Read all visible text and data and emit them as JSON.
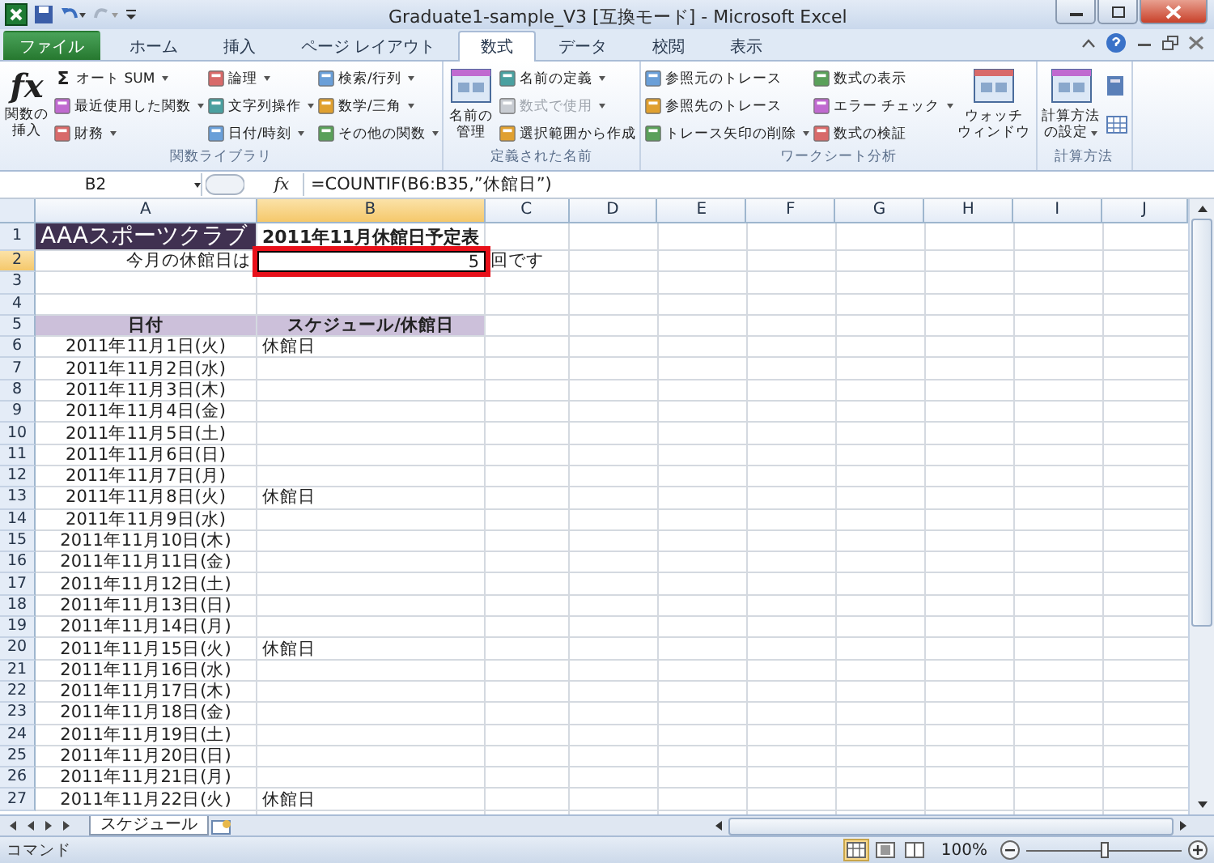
{
  "window": {
    "title": "Graduate1-sample_V3  [互換モード] - Microsoft Excel"
  },
  "tabs": [
    {
      "label": "ファイル",
      "selected": false,
      "kind": "file"
    },
    {
      "label": "ホーム",
      "selected": false,
      "kind": "tab"
    },
    {
      "label": "挿入",
      "selected": false,
      "kind": "tab"
    },
    {
      "label": "ページ レイアウト",
      "selected": false,
      "kind": "tab"
    },
    {
      "label": "数式",
      "selected": true,
      "kind": "tab"
    },
    {
      "label": "データ",
      "selected": false,
      "kind": "tab"
    },
    {
      "label": "校閲",
      "selected": false,
      "kind": "tab"
    },
    {
      "label": "表示",
      "selected": false,
      "kind": "tab"
    }
  ],
  "ribbon_groups": [
    {
      "label": "関数ライブラリ",
      "items": [
        {
          "kind": "large",
          "glyph": "fx",
          "lines": [
            "関数の",
            "挿入"
          ]
        },
        {
          "kind": "stack",
          "entries": [
            {
              "label": "オート SUM",
              "dropdown": true,
              "disabled": false,
              "glyph": "Σ"
            },
            {
              "label": "最近使用した関数",
              "dropdown": true,
              "disabled": false
            },
            {
              "label": "財務",
              "dropdown": true,
              "disabled": false
            }
          ]
        },
        {
          "kind": "stack",
          "entries": [
            {
              "label": "論理",
              "dropdown": true,
              "disabled": false
            },
            {
              "label": "文字列操作",
              "dropdown": true,
              "disabled": false
            },
            {
              "label": "日付/時刻",
              "dropdown": true,
              "disabled": false
            }
          ]
        },
        {
          "kind": "stack",
          "entries": [
            {
              "label": "検索/行列",
              "dropdown": true,
              "disabled": false
            },
            {
              "label": "数学/三角",
              "dropdown": true,
              "disabled": false
            },
            {
              "label": "その他の関数",
              "dropdown": true,
              "disabled": false
            }
          ]
        }
      ]
    },
    {
      "label": "定義された名前",
      "items": [
        {
          "kind": "large",
          "lines": [
            "名前の",
            "管理"
          ]
        },
        {
          "kind": "stack",
          "entries": [
            {
              "label": "名前の定義",
              "dropdown": true,
              "disabled": false
            },
            {
              "label": "数式で使用",
              "dropdown": true,
              "disabled": true
            },
            {
              "label": "選択範囲から作成",
              "dropdown": false,
              "disabled": false
            }
          ]
        }
      ]
    },
    {
      "label": "ワークシート分析",
      "items": [
        {
          "kind": "stack",
          "entries": [
            {
              "label": "参照元のトレース",
              "dropdown": false,
              "disabled": false
            },
            {
              "label": "参照先のトレース",
              "dropdown": false,
              "disabled": false
            },
            {
              "label": "トレース矢印の削除",
              "dropdown": true,
              "disabled": false
            }
          ]
        },
        {
          "kind": "stack",
          "entries": [
            {
              "label": "数式の表示",
              "dropdown": false,
              "disabled": false
            },
            {
              "label": "エラー チェック",
              "dropdown": true,
              "disabled": false
            },
            {
              "label": "数式の検証",
              "dropdown": false,
              "disabled": false
            }
          ]
        },
        {
          "kind": "large",
          "lines": [
            "ウォッチ",
            "ウィンドウ"
          ]
        }
      ]
    },
    {
      "label": "計算方法",
      "items": [
        {
          "kind": "large",
          "lines": [
            "計算方法",
            "の設定"
          ],
          "dropdown": true
        },
        {
          "kind": "icons"
        }
      ]
    }
  ],
  "name_box": "B2",
  "formula": "=COUNTIF(B6:B35,”休館日”)",
  "formula_glyph": "fx",
  "columns": [
    {
      "label": "A",
      "selected": false
    },
    {
      "label": "B",
      "selected": true
    },
    {
      "label": "C",
      "selected": false
    },
    {
      "label": "D",
      "selected": false
    },
    {
      "label": "E",
      "selected": false
    },
    {
      "label": "F",
      "selected": false
    },
    {
      "label": "G",
      "selected": false
    },
    {
      "label": "H",
      "selected": false
    },
    {
      "label": "I",
      "selected": false
    },
    {
      "label": "J",
      "selected": false
    }
  ],
  "rows": [
    {
      "number": "1",
      "selected": false,
      "kind": "title",
      "cells": [
        "AAAスポーツクラブ",
        "2011年11月休館日予定表"
      ]
    },
    {
      "number": "2",
      "selected": true,
      "kind": "count",
      "highlight": true,
      "cells": [
        "今月の休館日は",
        "5",
        "回です"
      ]
    },
    {
      "number": "3",
      "selected": false,
      "kind": "blank",
      "cells": []
    },
    {
      "number": "4",
      "selected": false,
      "kind": "blank",
      "cells": []
    },
    {
      "number": "5",
      "selected": false,
      "kind": "header",
      "cells": [
        "日付",
        "スケジュール/休館日"
      ]
    },
    {
      "number": "6",
      "selected": false,
      "kind": "data",
      "cells": [
        "2011年11月1日(火)",
        "休館日"
      ]
    },
    {
      "number": "7",
      "selected": false,
      "kind": "data",
      "cells": [
        "2011年11月2日(水)"
      ]
    },
    {
      "number": "8",
      "selected": false,
      "kind": "data",
      "cells": [
        "2011年11月3日(木)"
      ]
    },
    {
      "number": "9",
      "selected": false,
      "kind": "data",
      "cells": [
        "2011年11月4日(金)"
      ]
    },
    {
      "number": "10",
      "selected": false,
      "kind": "data",
      "cells": [
        "2011年11月5日(土)"
      ]
    },
    {
      "number": "11",
      "selected": false,
      "kind": "data",
      "cells": [
        "2011年11月6日(日)"
      ]
    },
    {
      "number": "12",
      "selected": false,
      "kind": "data",
      "cells": [
        "2011年11月7日(月)"
      ]
    },
    {
      "number": "13",
      "selected": false,
      "kind": "data",
      "cells": [
        "2011年11月8日(火)",
        "休館日"
      ]
    },
    {
      "number": "14",
      "selected": false,
      "kind": "data",
      "cells": [
        "2011年11月9日(水)"
      ]
    },
    {
      "number": "15",
      "selected": false,
      "kind": "data",
      "cells": [
        "2011年11月10日(木)"
      ]
    },
    {
      "number": "16",
      "selected": false,
      "kind": "data",
      "cells": [
        "2011年11月11日(金)"
      ]
    },
    {
      "number": "17",
      "selected": false,
      "kind": "data",
      "cells": [
        "2011年11月12日(土)"
      ]
    },
    {
      "number": "18",
      "selected": false,
      "kind": "data",
      "cells": [
        "2011年11月13日(日)"
      ]
    },
    {
      "number": "19",
      "selected": false,
      "kind": "data",
      "cells": [
        "2011年11月14日(月)"
      ]
    },
    {
      "number": "20",
      "selected": false,
      "kind": "data",
      "cells": [
        "2011年11月15日(火)",
        "休館日"
      ]
    },
    {
      "number": "21",
      "selected": false,
      "kind": "data",
      "cells": [
        "2011年11月16日(水)"
      ]
    },
    {
      "number": "22",
      "selected": false,
      "kind": "data",
      "cells": [
        "2011年11月17日(木)"
      ]
    },
    {
      "number": "23",
      "selected": false,
      "kind": "data",
      "cells": [
        "2011年11月18日(金)"
      ]
    },
    {
      "number": "24",
      "selected": false,
      "kind": "data",
      "cells": [
        "2011年11月19日(土)"
      ]
    },
    {
      "number": "25",
      "selected": false,
      "kind": "data",
      "cells": [
        "2011年11月20日(日)"
      ]
    },
    {
      "number": "26",
      "selected": false,
      "kind": "data",
      "cells": [
        "2011年11月21日(月)"
      ]
    },
    {
      "number": "27",
      "selected": false,
      "kind": "data",
      "cells": [
        "2011年11月22日(火)",
        "休館日"
      ]
    }
  ],
  "sheet_tabs": [
    {
      "label": "スケジュール",
      "selected": true
    }
  ],
  "status_bar": {
    "mode": "コマンド",
    "views": [
      {
        "selected": true
      },
      {
        "selected": false
      },
      {
        "selected": false
      }
    ],
    "zoom": "100%",
    "zoom_slider": {
      "level": 0.5
    }
  }
}
